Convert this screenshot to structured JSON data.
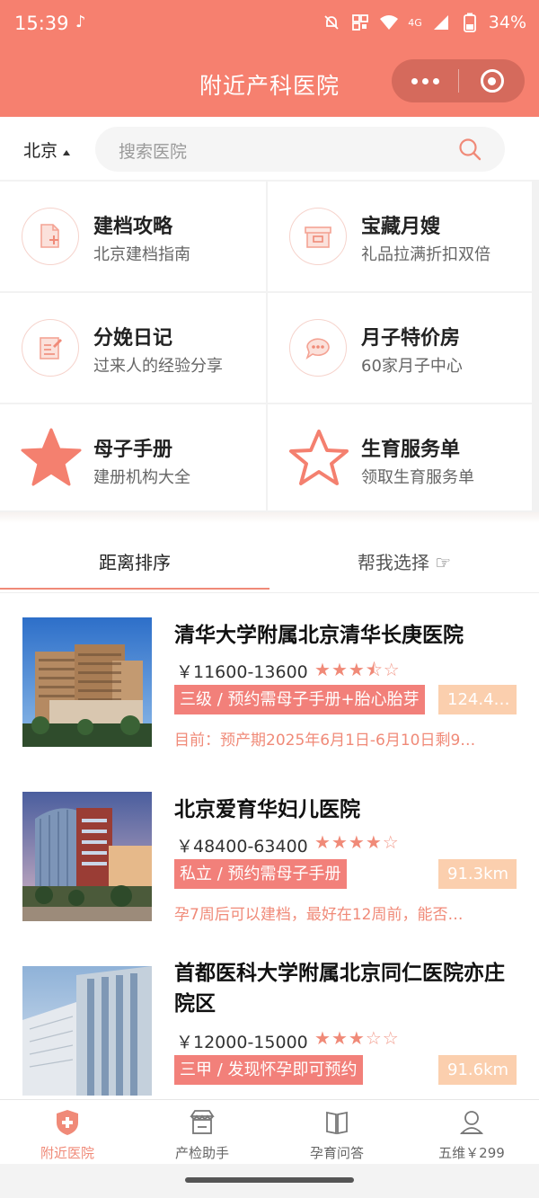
{
  "status_bar": {
    "time": "15:39",
    "battery": "34%",
    "network": "4G"
  },
  "header": {
    "title": "附近产科医院"
  },
  "search": {
    "city": "北京",
    "placeholder": "搜索医院"
  },
  "features": [
    {
      "title": "建档攻略",
      "subtitle": "北京建档指南",
      "icon": "document-add-icon"
    },
    {
      "title": "宝藏月嫂",
      "subtitle": "礼品拉满折扣双倍",
      "icon": "gift-box-icon"
    },
    {
      "title": "分娩日记",
      "subtitle": "过来人的经验分享",
      "icon": "diary-edit-icon"
    },
    {
      "title": "月子特价房",
      "subtitle": "60家月子中心",
      "icon": "chat-bubble-icon"
    },
    {
      "title": "母子手册",
      "subtitle": "建册机构大全",
      "icon": "star-filled-icon"
    },
    {
      "title": "生育服务单",
      "subtitle": "领取生育服务单",
      "icon": "star-outline-icon"
    }
  ],
  "tabs": [
    {
      "label": "距离排序",
      "active": true
    },
    {
      "label": "帮我选择 ☞",
      "active": false
    }
  ],
  "hospitals": [
    {
      "name": "清华大学附属北京清华长庚医院",
      "price": "￥11600-13600",
      "rating": 3.5,
      "tag": "三级 / 预约需母子手册+胎心胎芽",
      "distance": "124.4…",
      "note": "目前：预产期2025年6月1日-6月10日剩9…"
    },
    {
      "name": "北京爱育华妇儿医院",
      "price": "￥48400-63400",
      "rating": 4,
      "tag": "私立 / 预约需母子手册",
      "distance": "91.3km",
      "note": "孕7周后可以建档，最好在12周前，能否…"
    },
    {
      "name": "首都医科大学附属北京同仁医院亦庄院区",
      "price": "￥12000-15000",
      "rating": 3,
      "tag": "三甲 / 发现怀孕即可预约",
      "distance": "91.6km",
      "note": ""
    }
  ],
  "bottom_nav": [
    {
      "label": "附近医院",
      "icon": "hospital-shield-icon",
      "active": true
    },
    {
      "label": "产检助手",
      "icon": "clinic-awning-icon",
      "active": false
    },
    {
      "label": "孕育问答",
      "icon": "book-open-icon",
      "active": false
    },
    {
      "label": "五维￥299",
      "icon": "baby-user-icon",
      "active": false
    }
  ],
  "colors": {
    "brand": "#f6806f",
    "accent": "#f08a78",
    "tag_bg": "#f2807a",
    "distance_bg": "#fbcfae"
  }
}
